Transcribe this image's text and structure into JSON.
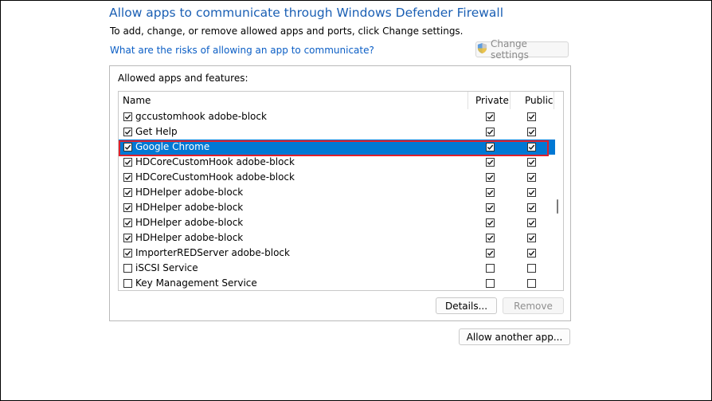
{
  "header": {
    "title": "Allow apps to communicate through Windows Defender Firewall",
    "subtitle": "To add, change, or remove allowed apps and ports, click Change settings.",
    "risk_link": "What are the risks of allowing an app to communicate?",
    "change_settings_label": "Change settings"
  },
  "apps": {
    "group_label": "Allowed apps and features:",
    "columns": {
      "name": "Name",
      "private": "Private",
      "public": "Public"
    },
    "rows": [
      {
        "name": "gccustomhook adobe-block",
        "enabled": true,
        "private": true,
        "public": true,
        "selected": false
      },
      {
        "name": "Get Help",
        "enabled": true,
        "private": true,
        "public": true,
        "selected": false
      },
      {
        "name": "Google Chrome",
        "enabled": true,
        "private": true,
        "public": true,
        "selected": true
      },
      {
        "name": "HDCoreCustomHook adobe-block",
        "enabled": true,
        "private": true,
        "public": true,
        "selected": false
      },
      {
        "name": "HDCoreCustomHook adobe-block",
        "enabled": true,
        "private": true,
        "public": true,
        "selected": false
      },
      {
        "name": "HDHelper adobe-block",
        "enabled": true,
        "private": true,
        "public": true,
        "selected": false
      },
      {
        "name": "HDHelper adobe-block",
        "enabled": true,
        "private": true,
        "public": true,
        "selected": false
      },
      {
        "name": "HDHelper adobe-block",
        "enabled": true,
        "private": true,
        "public": true,
        "selected": false
      },
      {
        "name": "HDHelper adobe-block",
        "enabled": true,
        "private": true,
        "public": true,
        "selected": false
      },
      {
        "name": "ImporterREDServer adobe-block",
        "enabled": true,
        "private": true,
        "public": true,
        "selected": false
      },
      {
        "name": "iSCSI Service",
        "enabled": false,
        "private": false,
        "public": false,
        "selected": false
      },
      {
        "name": "Key Management Service",
        "enabled": false,
        "private": false,
        "public": false,
        "selected": false
      }
    ],
    "details_label": "Details...",
    "remove_label": "Remove"
  },
  "allow_another_label": "Allow another app...",
  "colors": {
    "title": "#1a5fb4",
    "link": "#0b5ec5",
    "selection": "#0078d4",
    "highlight_border": "#e0202b"
  },
  "icons": {
    "change_settings": "uac-shield-icon",
    "checkbox_checked": "checkmark-icon"
  }
}
